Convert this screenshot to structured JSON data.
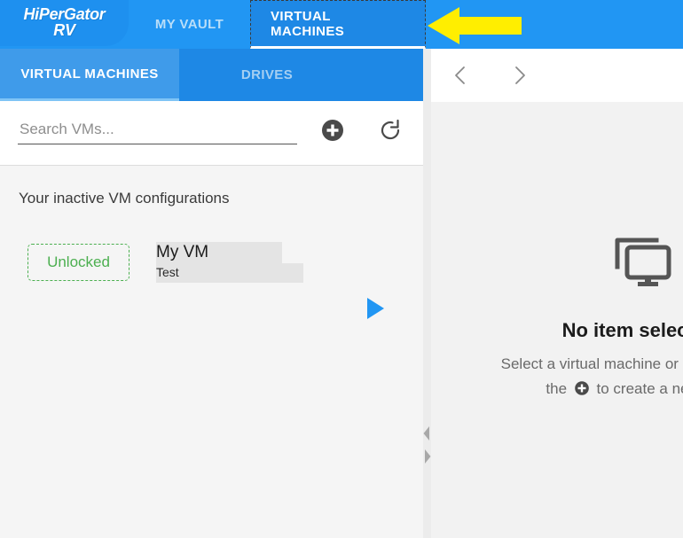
{
  "app": {
    "logo_line1": "HiPerGator",
    "logo_line2": "RV"
  },
  "colors": {
    "header_blue": "#2196f3",
    "logo_blue": "#1e90ef",
    "active_tab_blue": "#1e88e5",
    "subtab_active_blue": "#3f9bea",
    "subtab_underline": "#7fc4f5",
    "unlocked_green": "#4caf50",
    "play_blue": "#2196f3",
    "annotation_yellow": "#ffee00",
    "panel_gray": "#f2f2f2",
    "highlight_gray": "#e4e4e4"
  },
  "main_tabs": [
    {
      "label": "MY VAULT",
      "active": false
    },
    {
      "label": "VIRTUAL MACHINES",
      "active": true
    }
  ],
  "sub_tabs": [
    {
      "label": "VIRTUAL MACHINES",
      "active": true
    },
    {
      "label": "DRIVES",
      "active": false
    }
  ],
  "search": {
    "placeholder": "Search VMs...",
    "value": "",
    "add_icon": "plus-circle-icon",
    "refresh_icon": "refresh-icon"
  },
  "left_panel": {
    "section_title": "Your inactive VM configurations",
    "vms": [
      {
        "status": "Unlocked",
        "name": "My VM",
        "description": "Test",
        "action_icon": "play-icon"
      }
    ]
  },
  "right_panel": {
    "nav_prev_icon": "chevron-left-icon",
    "nav_next_icon": "chevron-right-icon",
    "empty_icon": "devices-monitor-icon",
    "empty_title": "No item selected",
    "empty_desc_line1": "Select a virtual machine or drive, or press",
    "empty_desc_line2_before": "the",
    "empty_desc_line2_after": "to create a new one."
  },
  "annotation": {
    "arrow_icon": "left-arrow-annotation",
    "points_to": "VIRTUAL MACHINES"
  },
  "splitter": {
    "collapse_icon": "triangle-left-icon",
    "expand_icon": "triangle-right-icon"
  }
}
